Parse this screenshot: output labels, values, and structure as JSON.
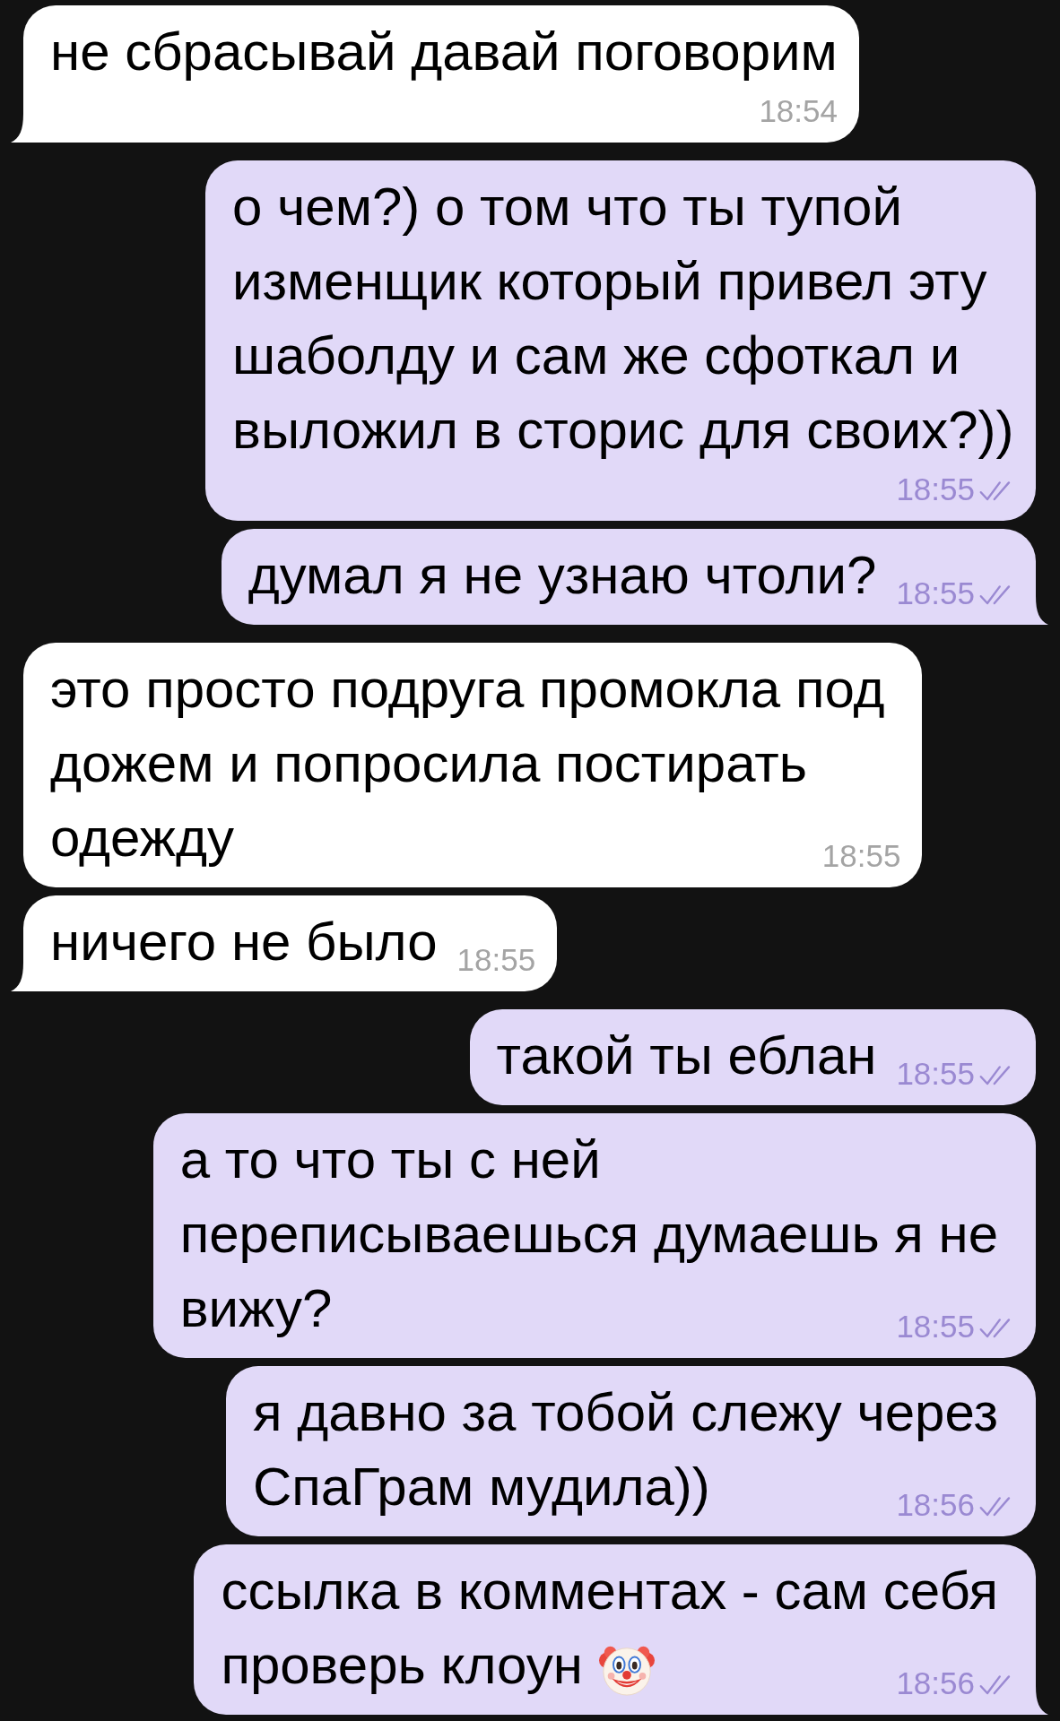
{
  "messages": [
    {
      "kind": "incoming",
      "text": "не сбрасывай давай поговорим",
      "time": "18:54",
      "tail": true
    },
    {
      "kind": "outgoing",
      "text": "о чем?) о том что ты тупой\nизменщик который привел эту\nшаболду и сам же сфоткал и\nвыложил в сторис для своих?))",
      "time": "18:55",
      "read": true,
      "tail": false
    },
    {
      "kind": "outgoing",
      "text": "думал я не узнаю чтоли?",
      "time": "18:55",
      "read": true,
      "tail": true
    },
    {
      "kind": "incoming",
      "text": "это просто подруга промокла под\nдожем и попросила постирать\nодежду",
      "time": "18:55",
      "tail": false
    },
    {
      "kind": "incoming",
      "text": "ничего не было",
      "time": "18:55",
      "tail": true
    },
    {
      "kind": "outgoing",
      "text": "такой ты еблан",
      "time": "18:55",
      "read": true,
      "tail": false
    },
    {
      "kind": "outgoing",
      "text": "а то что ты с ней\nпереписываешься думаешь я не\nвижу?",
      "time": "18:55",
      "read": true,
      "tail": false
    },
    {
      "kind": "outgoing",
      "text": "я давно за тобой слежу через\nСпаГрам мудила))",
      "time": "18:56",
      "read": true,
      "tail": false
    },
    {
      "kind": "outgoing",
      "text": "ссылка в комментах - сам себя\nпроверь клоун",
      "time": "18:56",
      "read": true,
      "tail": true,
      "emoji": true
    }
  ]
}
